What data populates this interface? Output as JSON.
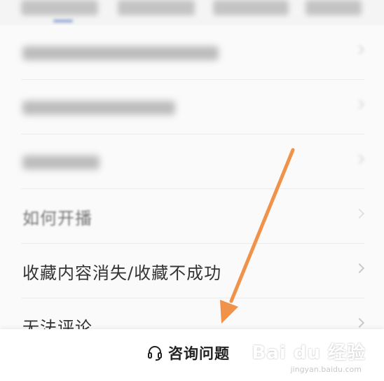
{
  "rows": [
    {
      "label": "如何开播"
    },
    {
      "label": "收藏内容消失/收藏不成功"
    },
    {
      "label": "无法评论"
    }
  ],
  "bottom_bar": {
    "icon": "headset-icon",
    "label": "咨询问题"
  },
  "annotation": {
    "icon": "orange-arrow",
    "color": "#f0924a"
  },
  "watermark": {
    "brand": "Bai du 经验",
    "url": "jingyan.baidu.com"
  }
}
